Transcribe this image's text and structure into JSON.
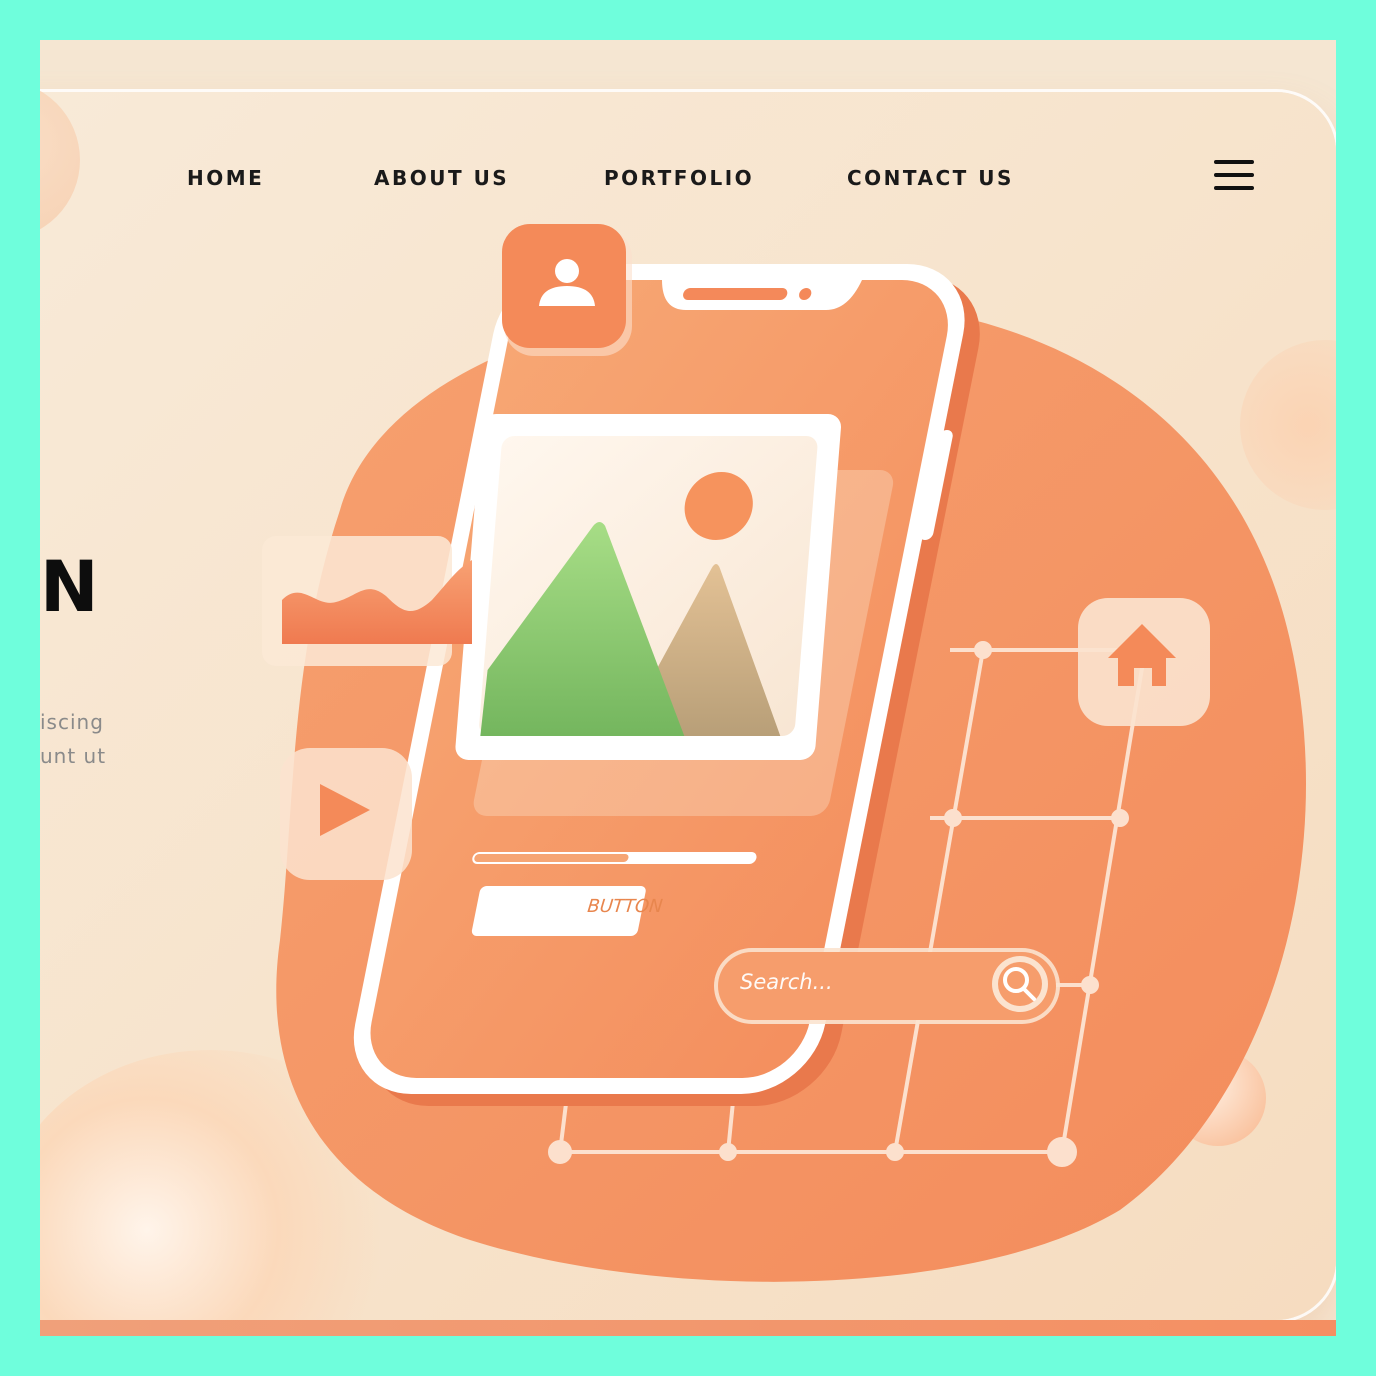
{
  "nav": {
    "items": [
      {
        "label": "HOME"
      },
      {
        "label": "ABOUT US"
      },
      {
        "label": "PORTFOLIO"
      },
      {
        "label": "CONTACT US"
      }
    ],
    "menu_icon": "hamburger-icon"
  },
  "hero": {
    "title_fragment": "N",
    "text_lines": [
      "iscing",
      "unt  ut"
    ]
  },
  "mockup": {
    "button_label": "BUTTON",
    "search_placeholder": "Search...",
    "progress": 0.55,
    "icons": [
      "user-icon",
      "image-icon",
      "line-chart-icon",
      "play-icon",
      "home-icon",
      "search-icon"
    ]
  },
  "colors": {
    "accent": "#f4925f",
    "background": "#f7e3cb",
    "frame": "#6ffedc",
    "text": "#1a1a1a"
  }
}
